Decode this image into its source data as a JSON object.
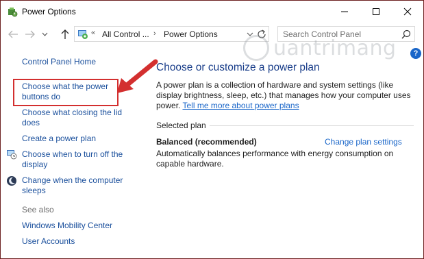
{
  "window": {
    "title": "Power Options"
  },
  "navbar": {
    "address_sep": "«",
    "breadcrumb": [
      "All Control ...",
      "Power Options"
    ],
    "crumb_sep": "›",
    "search_placeholder": "Search Control Panel"
  },
  "watermark": {
    "text": "uantrimang"
  },
  "help": {
    "label": "?"
  },
  "sidebar": {
    "home": "Control Panel Home",
    "items": [
      {
        "label_line1": "Choose what the power",
        "label_line2": "buttons do",
        "icon": "none"
      },
      {
        "label_line1": "Choose what closing the lid",
        "label_line2": "does",
        "icon": "none"
      },
      {
        "label_line1": "Create a power plan",
        "label_line2": "",
        "icon": "none"
      },
      {
        "label_line1": "Choose when to turn off the",
        "label_line2": "display",
        "icon": "monitor-clock-icon"
      },
      {
        "label_line1": "Change when the computer",
        "label_line2": "sleeps",
        "icon": "moon-icon"
      }
    ],
    "see_also_label": "See also",
    "see_also": [
      "Windows Mobility Center",
      "User Accounts"
    ]
  },
  "main": {
    "title": "Choose or customize a power plan",
    "description": "A power plan is a collection of hardware and system settings (like display brightness, sleep, etc.) that manages how your computer uses power.",
    "learn_more": "Tell me more about power plans",
    "section_label": "Selected plan",
    "plan": {
      "name": "Balanced (recommended)",
      "change_link": "Change plan settings",
      "description": "Automatically balances performance with energy consumption on capable hardware."
    }
  },
  "colors": {
    "link": "#1a66c9",
    "sidebar_link": "#1a4f9c",
    "title": "#1a3e8a",
    "highlight": "#d32f2f",
    "window_border": "#6b1f1f"
  }
}
